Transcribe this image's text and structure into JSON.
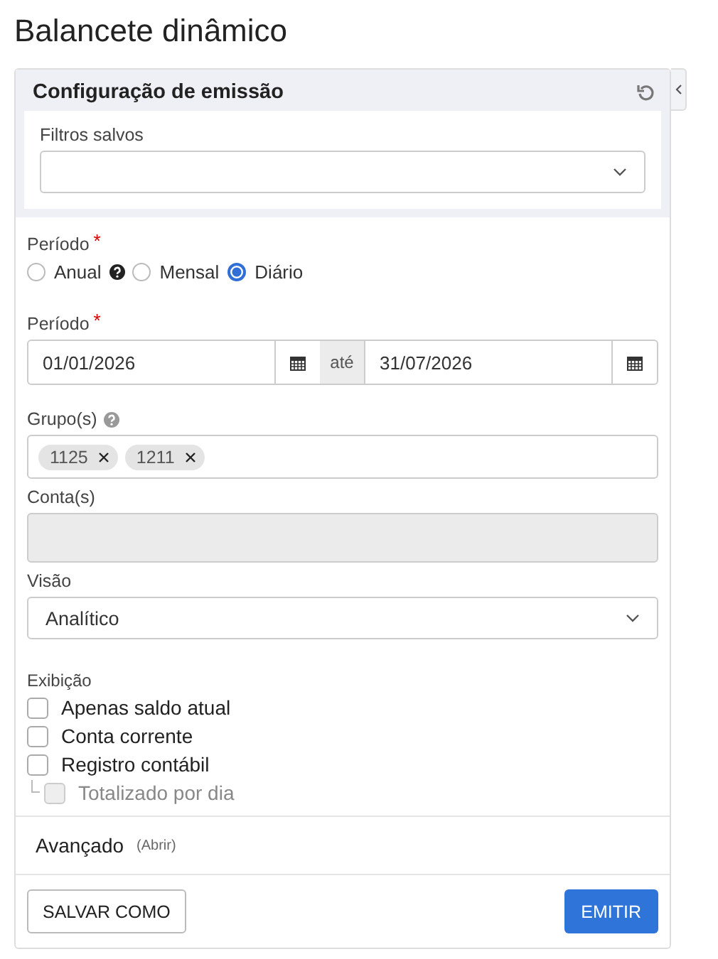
{
  "page_title": "Balancete dinâmico",
  "panel": {
    "title": "Configuração de emissão"
  },
  "saved_filters": {
    "label": "Filtros salvos"
  },
  "period_type": {
    "label": "Período",
    "required_mark": "*",
    "options": [
      {
        "label": "Anual",
        "selected": false,
        "help": true
      },
      {
        "label": "Mensal",
        "selected": false
      },
      {
        "label": "Diário",
        "selected": true
      }
    ]
  },
  "period": {
    "label": "Período",
    "required_mark": "*",
    "start": "01/01/2026",
    "separator": "até",
    "end": "31/07/2026"
  },
  "groups": {
    "label": "Grupo(s)",
    "help": true,
    "tags": [
      "1125",
      "1211"
    ]
  },
  "accounts": {
    "label": "Conta(s)",
    "disabled": true
  },
  "view": {
    "label": "Visão",
    "value": "Analítico"
  },
  "display": {
    "label": "Exibição",
    "options": [
      {
        "label": "Apenas saldo atual",
        "checked": false,
        "disabled": false
      },
      {
        "label": "Conta corrente",
        "checked": false,
        "disabled": false
      },
      {
        "label": "Registro contábil",
        "checked": false,
        "disabled": false,
        "children": [
          {
            "label": "Totalizado por dia",
            "checked": false,
            "disabled": true
          }
        ]
      }
    ]
  },
  "advanced": {
    "label": "Avançado",
    "toggle": "(Abrir)"
  },
  "buttons": {
    "save_as": "SALVAR COMO",
    "emit": "EMITIR"
  }
}
